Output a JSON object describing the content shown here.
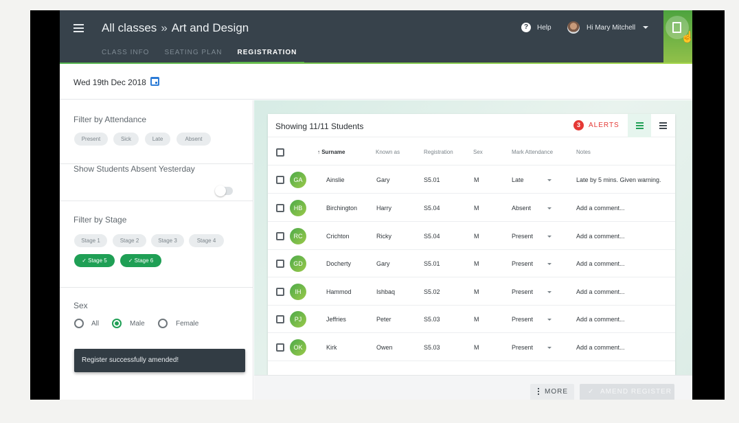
{
  "header": {
    "breadcrumb_root": "All classes",
    "breadcrumb_sep": "»",
    "breadcrumb_current": "Art and Design",
    "tabs": [
      {
        "label": "CLASS INFO",
        "active": false
      },
      {
        "label": "SEATING PLAN",
        "active": false
      },
      {
        "label": "REGISTRATION",
        "active": true
      }
    ],
    "help_label": "Help",
    "user_label": "Hi Mary Mitchell"
  },
  "date_bar": {
    "date": "Wed 19th Dec 2018"
  },
  "sidebar": {
    "attendance": {
      "title": "Filter by Attendance",
      "chips": [
        "Present",
        "Sick",
        "Late",
        "Absent"
      ]
    },
    "absent_yesterday": {
      "label": "Show Students Absent Yesterday",
      "enabled": false
    },
    "stage": {
      "title": "Filter by Stage",
      "chips": [
        "Stage 1",
        "Stage 2",
        "Stage 3",
        "Stage 4"
      ],
      "selected_chips": [
        "✓ Stage 5",
        "✓ Stage 6"
      ]
    },
    "sex": {
      "title": "Sex",
      "options": [
        "All",
        "Male",
        "Female"
      ],
      "selected": "Male"
    },
    "snackbar": "Register successfully amended!"
  },
  "table": {
    "showing": "Showing 11/11 Students",
    "alerts_count": "3",
    "alerts_label": "ALERTS",
    "columns": [
      "↑ Surname",
      "Known as",
      "Registration",
      "Sex",
      "Mark Attendance",
      "Notes"
    ],
    "rows": [
      {
        "initials": "GA",
        "surname": "Ainslie",
        "known_as": "Gary",
        "registration": "S5.01",
        "sex": "M",
        "attendance": "Late",
        "notes": "Late by 5 mins. Given warning."
      },
      {
        "initials": "HB",
        "surname": "Birchington",
        "known_as": "Harry",
        "registration": "S5.04",
        "sex": "M",
        "attendance": "Absent",
        "notes": "Add a comment..."
      },
      {
        "initials": "RC",
        "surname": "Crichton",
        "known_as": "Ricky",
        "registration": "S5.04",
        "sex": "M",
        "attendance": "Present",
        "notes": "Add a comment..."
      },
      {
        "initials": "GD",
        "surname": "Docherty",
        "known_as": "Gary",
        "registration": "S5.01",
        "sex": "M",
        "attendance": "Present",
        "notes": "Add a comment..."
      },
      {
        "initials": "IH",
        "surname": "Hammod",
        "known_as": "Ishbaq",
        "registration": "S5.02",
        "sex": "M",
        "attendance": "Present",
        "notes": "Add a comment..."
      },
      {
        "initials": "PJ",
        "surname": "Jeffries",
        "known_as": "Peter",
        "registration": "S5.03",
        "sex": "M",
        "attendance": "Present",
        "notes": "Add a comment..."
      },
      {
        "initials": "OK",
        "surname": "Kirk",
        "known_as": "Owen",
        "registration": "S5.03",
        "sex": "M",
        "attendance": "Present",
        "notes": "Add a comment..."
      }
    ]
  },
  "footer": {
    "more_label": "MORE",
    "amend_label": "AMEND REGISTER"
  },
  "colors": {
    "accent": "#1f9f55",
    "header": "#37424b",
    "alert": "#e53935"
  }
}
